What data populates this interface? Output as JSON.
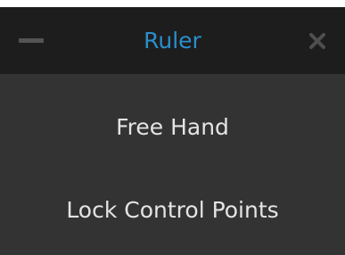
{
  "panel": {
    "title": "Ruler",
    "minimize_icon": "minimize-icon",
    "close_icon": "close-icon",
    "accent_color": "#2a8fcc",
    "items": [
      {
        "label": "Free Hand"
      },
      {
        "label": "Lock Control Points"
      }
    ]
  }
}
